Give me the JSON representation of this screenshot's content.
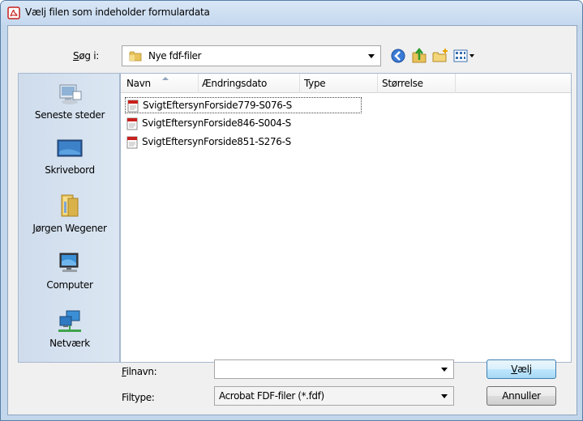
{
  "window": {
    "title": "Vælj filen som indeholder formulardata"
  },
  "lookin": {
    "label": "Søg i:",
    "label_hotkey": "S",
    "label_rest": "øg i:",
    "value": "Nye fdf-filer"
  },
  "toolbar": {
    "icons": [
      "back-icon",
      "up-folder-icon",
      "new-folder-icon",
      "view-menu-icon"
    ]
  },
  "places": [
    {
      "label": "Seneste steder",
      "icon": "recent-places-icon"
    },
    {
      "label": "Skrivebord",
      "icon": "desktop-icon"
    },
    {
      "label": "Jørgen Wegener",
      "icon": "user-folder-icon"
    },
    {
      "label": "Computer",
      "icon": "computer-icon"
    },
    {
      "label": "Netværk",
      "icon": "network-icon"
    }
  ],
  "columns": [
    "Navn",
    "Ændringsdato",
    "Type",
    "Størrelse"
  ],
  "files": [
    {
      "name": "SvigtEftersynForside779-S076-S",
      "selected": true
    },
    {
      "name": "SvigtEftersynForside846-S004-S",
      "selected": false
    },
    {
      "name": "SvigtEftersynForside851-S276-S",
      "selected": false
    }
  ],
  "filename": {
    "label": "Filnavn:",
    "label_hotkey": "F",
    "label_rest": "ilnavn:",
    "value": ""
  },
  "filetype": {
    "label": "Filtype:",
    "value": "Acrobat FDF-filer (*.fdf)"
  },
  "buttons": {
    "open": "Vælj",
    "open_hotkey": "V",
    "open_rest": "ælj",
    "cancel": "Annuller"
  },
  "colors": {
    "titlebar": "#c4d8ee",
    "pdf_red": "#c8211d",
    "folder_yellow": "#e8c25a"
  }
}
